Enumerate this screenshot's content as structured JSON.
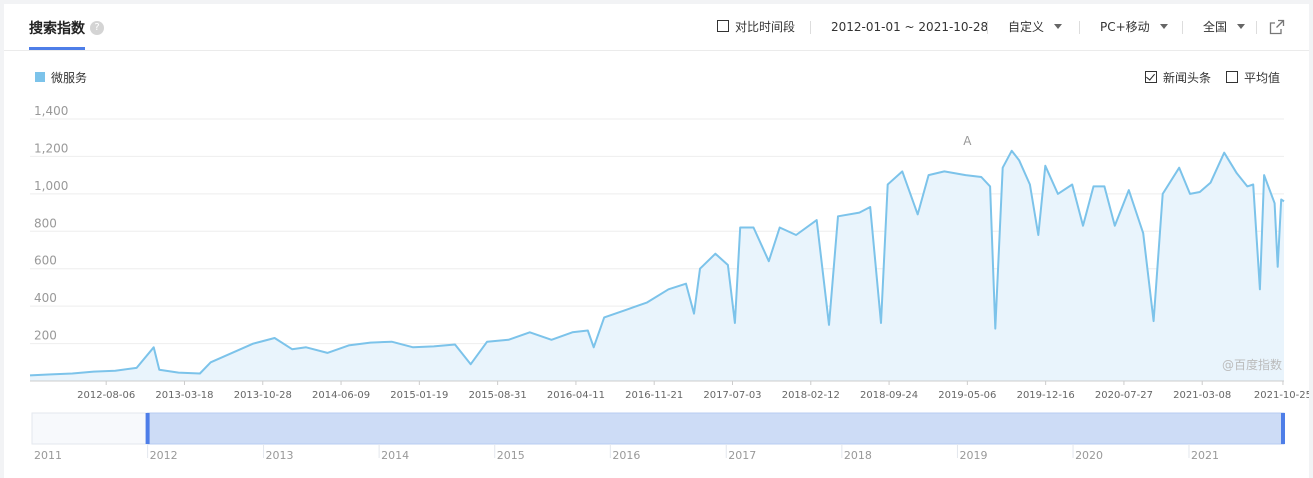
{
  "header": {
    "tab_title": "搜索指数",
    "help_glyph": "?",
    "compare_label": "对比时间段",
    "date_range": "2012-01-01 ~ 2021-10-28",
    "custom_label": "自定义",
    "device_label": "PC+移动",
    "region_label": "全国"
  },
  "legend": {
    "series_name": "微服务",
    "news_label": "新闻头条",
    "avg_label": "平均值"
  },
  "watermark": "@百度指数",
  "annotation_letter": "A",
  "colors": {
    "line": "#7cc3ea",
    "fill": "#e9f4fc",
    "accent": "#4e7ee8"
  },
  "chart_data": {
    "type": "line",
    "series": [
      {
        "name": "微服务"
      }
    ],
    "ylim": [
      0,
      1400
    ],
    "yticks": [
      200,
      400,
      600,
      800,
      1000,
      1200,
      1400
    ],
    "ytick_labels": [
      "200",
      "400",
      "600",
      "800",
      "1,000",
      "1,200",
      "1,400"
    ],
    "x_tick_labels": [
      "2012-08-06",
      "2013-03-18",
      "2013-10-28",
      "2014-06-09",
      "2015-01-19",
      "2015-08-31",
      "2016-04-11",
      "2016-11-21",
      "2017-07-03",
      "2018-02-12",
      "2018-09-24",
      "2019-05-06",
      "2019-12-16",
      "2020-07-27",
      "2021-03-08",
      "2021-10-25"
    ],
    "x_start": "2012-01-01",
    "x_end": "2021-10-28",
    "points": [
      [
        "2012-01-01",
        30
      ],
      [
        "2012-03-01",
        35
      ],
      [
        "2012-05-01",
        40
      ],
      [
        "2012-07-01",
        50
      ],
      [
        "2012-09-01",
        55
      ],
      [
        "2012-11-01",
        70
      ],
      [
        "2012-12-20",
        180
      ],
      [
        "2013-01-05",
        60
      ],
      [
        "2013-03-01",
        45
      ],
      [
        "2013-05-01",
        40
      ],
      [
        "2013-06-01",
        100
      ],
      [
        "2013-08-01",
        150
      ],
      [
        "2013-10-01",
        200
      ],
      [
        "2013-12-01",
        230
      ],
      [
        "2014-01-20",
        170
      ],
      [
        "2014-03-01",
        180
      ],
      [
        "2014-05-01",
        150
      ],
      [
        "2014-07-01",
        190
      ],
      [
        "2014-09-01",
        205
      ],
      [
        "2014-11-01",
        210
      ],
      [
        "2015-01-01",
        180
      ],
      [
        "2015-03-01",
        185
      ],
      [
        "2015-05-01",
        195
      ],
      [
        "2015-06-15",
        90
      ],
      [
        "2015-08-01",
        210
      ],
      [
        "2015-10-01",
        220
      ],
      [
        "2015-12-01",
        260
      ],
      [
        "2016-02-01",
        220
      ],
      [
        "2016-04-01",
        260
      ],
      [
        "2016-05-15",
        270
      ],
      [
        "2016-06-01",
        180
      ],
      [
        "2016-07-01",
        340
      ],
      [
        "2016-09-01",
        380
      ],
      [
        "2016-11-01",
        420
      ],
      [
        "2017-01-01",
        490
      ],
      [
        "2017-02-20",
        520
      ],
      [
        "2017-03-15",
        360
      ],
      [
        "2017-04-01",
        600
      ],
      [
        "2017-05-15",
        680
      ],
      [
        "2017-06-20",
        620
      ],
      [
        "2017-07-10",
        310
      ],
      [
        "2017-07-25",
        820
      ],
      [
        "2017-09-01",
        820
      ],
      [
        "2017-10-15",
        640
      ],
      [
        "2017-11-15",
        820
      ],
      [
        "2018-01-01",
        780
      ],
      [
        "2018-03-01",
        860
      ],
      [
        "2018-04-05",
        300
      ],
      [
        "2018-05-01",
        880
      ],
      [
        "2018-07-01",
        900
      ],
      [
        "2018-08-01",
        930
      ],
      [
        "2018-09-01",
        310
      ],
      [
        "2018-09-20",
        1050
      ],
      [
        "2018-11-01",
        1120
      ],
      [
        "2018-12-15",
        890
      ],
      [
        "2019-01-15",
        1100
      ],
      [
        "2019-03-01",
        1120
      ],
      [
        "2019-05-01",
        1100
      ],
      [
        "2019-06-15",
        1090
      ],
      [
        "2019-07-10",
        1040
      ],
      [
        "2019-07-25",
        280
      ],
      [
        "2019-08-15",
        1140
      ],
      [
        "2019-09-10",
        1230
      ],
      [
        "2019-10-01",
        1180
      ],
      [
        "2019-11-01",
        1050
      ],
      [
        "2019-11-25",
        780
      ],
      [
        "2019-12-15",
        1150
      ],
      [
        "2020-01-20",
        1000
      ],
      [
        "2020-03-01",
        1050
      ],
      [
        "2020-04-01",
        830
      ],
      [
        "2020-05-01",
        1040
      ],
      [
        "2020-06-01",
        1040
      ],
      [
        "2020-07-01",
        830
      ],
      [
        "2020-08-10",
        1020
      ],
      [
        "2020-09-20",
        790
      ],
      [
        "2020-10-20",
        320
      ],
      [
        "2020-11-15",
        1000
      ],
      [
        "2021-01-01",
        1140
      ],
      [
        "2021-02-01",
        1000
      ],
      [
        "2021-03-01",
        1010
      ],
      [
        "2021-04-01",
        1060
      ],
      [
        "2021-05-10",
        1220
      ],
      [
        "2021-06-15",
        1110
      ],
      [
        "2021-07-15",
        1040
      ],
      [
        "2021-08-01",
        1050
      ],
      [
        "2021-08-20",
        490
      ],
      [
        "2021-09-01",
        1100
      ],
      [
        "2021-10-01",
        950
      ],
      [
        "2021-10-10",
        610
      ],
      [
        "2021-10-20",
        970
      ],
      [
        "2021-10-28",
        960
      ]
    ]
  },
  "navigator": {
    "year_labels": [
      "2011",
      "2012",
      "2013",
      "2014",
      "2015",
      "2016",
      "2017",
      "2018",
      "2019",
      "2020",
      "2021"
    ]
  }
}
